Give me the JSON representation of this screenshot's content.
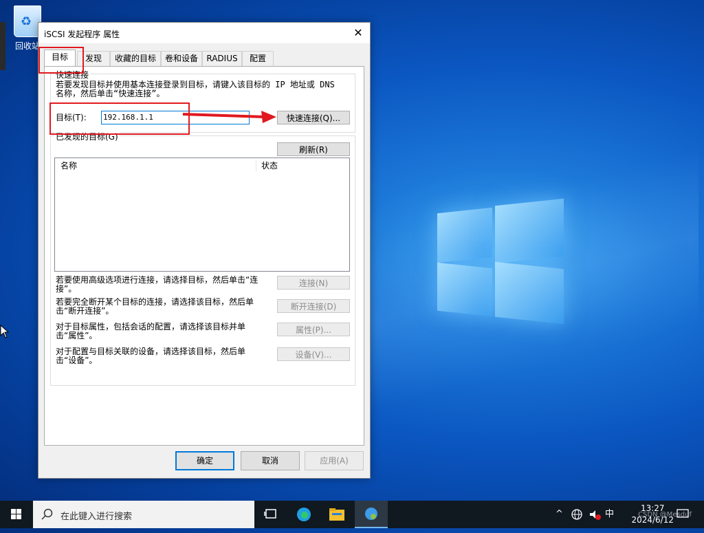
{
  "desktop": {
    "recycle_bin_label": "回收站",
    "watermark": "CSDN @Mesduf"
  },
  "dialog": {
    "title": "iSCSI 发起程序 属性",
    "close_glyph": "✕",
    "tabs": [
      {
        "label": "目标",
        "active": true
      },
      {
        "label": "发现"
      },
      {
        "label": "收藏的目标"
      },
      {
        "label": "卷和设备"
      },
      {
        "label": "RADIUS"
      },
      {
        "label": "配置"
      }
    ],
    "quick_connect": {
      "title": "快速连接",
      "description": "若要发现目标并使用基本连接登录到目标，请键入该目标的 IP 地址或 DNS 名称，然后单击“快速连接”。",
      "target_label": "目标(T):",
      "target_value": "192.168.1.1",
      "button": "快速连接(Q)..."
    },
    "discovered": {
      "title": "已发现的目标(G)",
      "refresh_button": "刷新(R)",
      "columns": [
        "名称",
        "状态"
      ]
    },
    "actions": [
      {
        "desc": "若要使用高级选项进行连接，请选择目标，然后单击“连接”。",
        "button": "连接(N)"
      },
      {
        "desc": "若要完全断开某个目标的连接，请选择该目标，然后单击“断开连接”。",
        "button": "断开连接(D)"
      },
      {
        "desc": "对于目标属性，包括会话的配置，请选择该目标并单击“属性”。",
        "button": "属性(P)..."
      },
      {
        "desc": "对于配置与目标关联的设备，请选择该目标，然后单击“设备”。",
        "button": "设备(V)..."
      }
    ],
    "footer": {
      "ok": "确定",
      "cancel": "取消",
      "apply": "应用(A)"
    }
  },
  "taskbar": {
    "search_placeholder": "在此键入进行搜索",
    "tray_caret": "^",
    "ime": "中",
    "time": "13:27",
    "date": "2024/6/12"
  },
  "colors": {
    "annotation": "#e0191f",
    "accent": "#0078d7"
  }
}
